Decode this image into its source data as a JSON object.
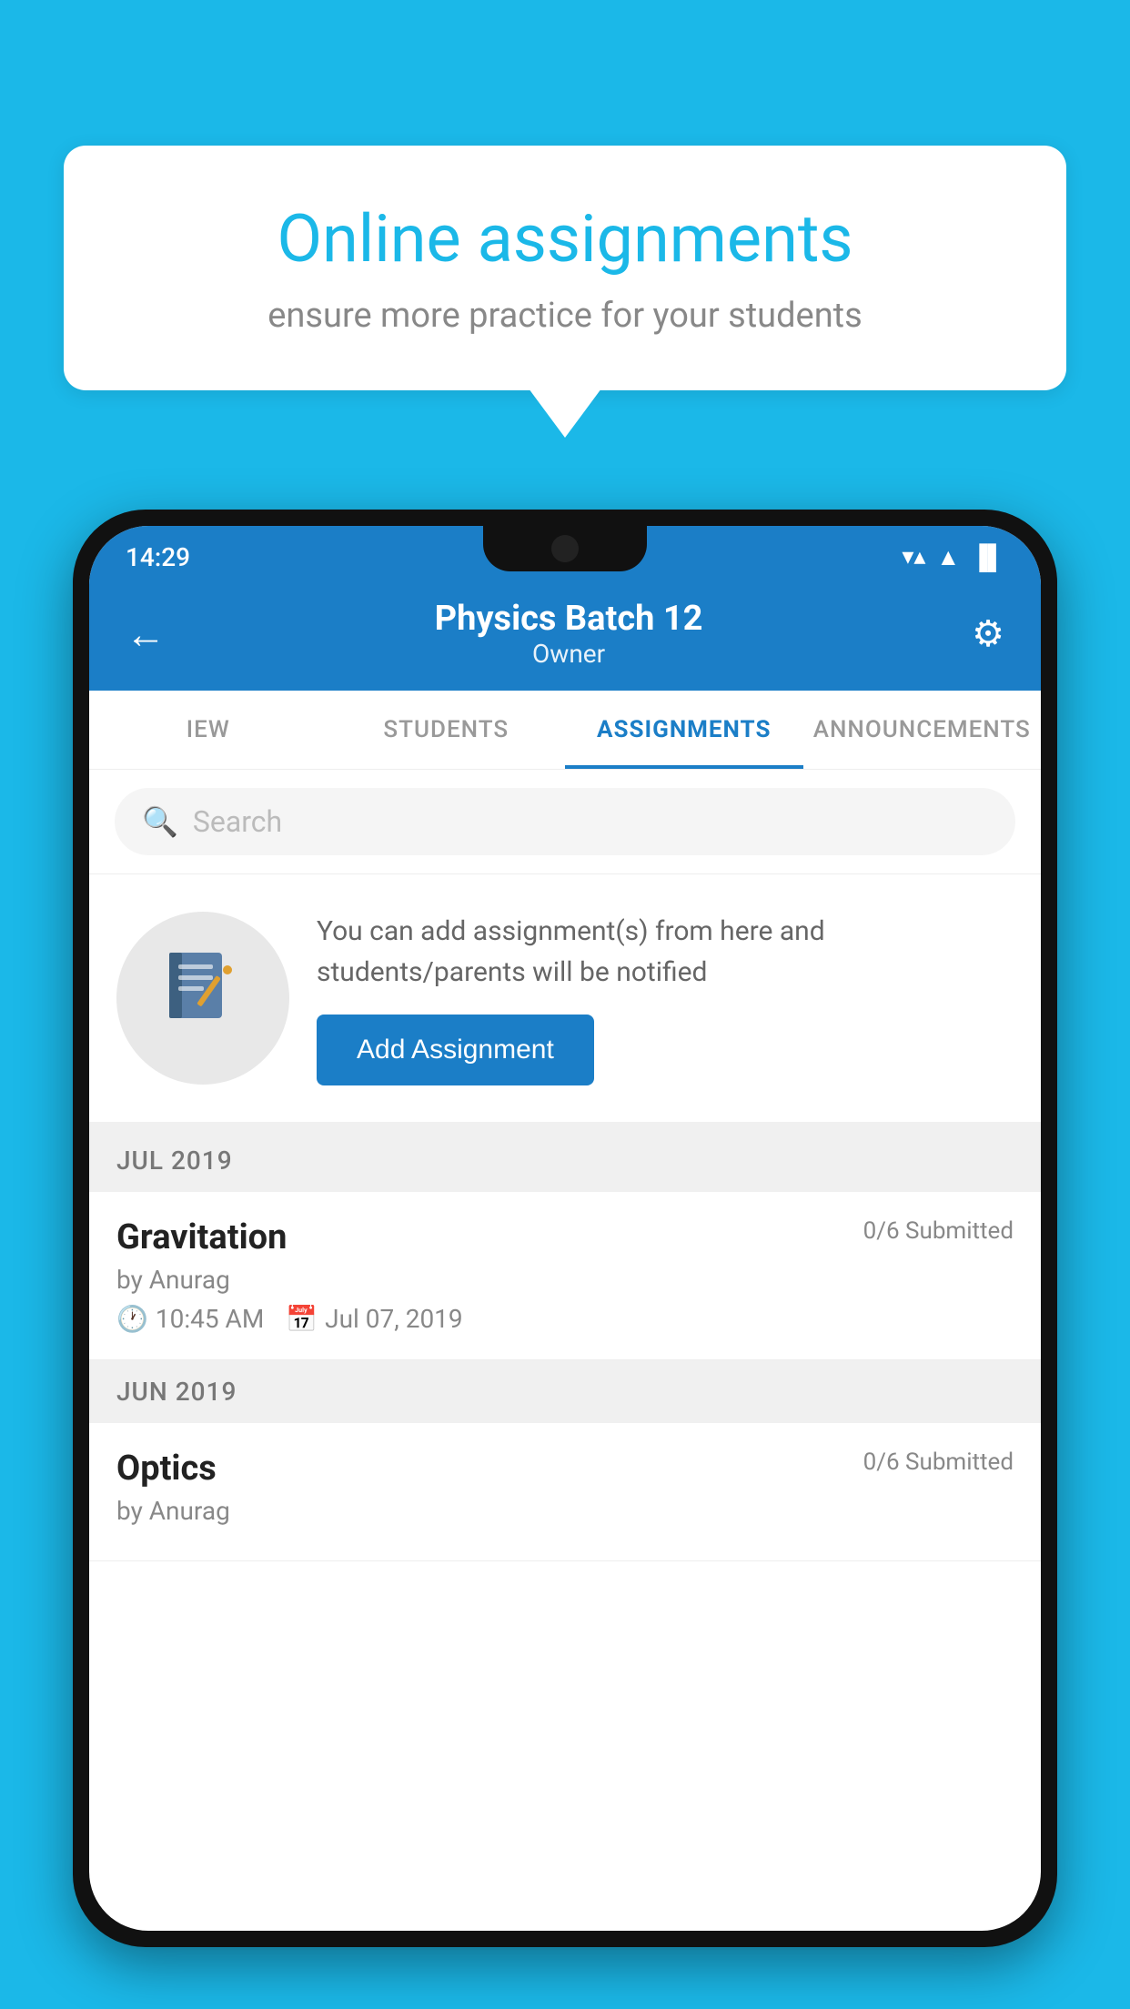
{
  "background_color": "#1BB8E8",
  "speech_bubble": {
    "title": "Online assignments",
    "subtitle": "ensure more practice for your students"
  },
  "phone": {
    "status_bar": {
      "time": "14:29",
      "wifi_icon": "▼",
      "signal_icon": "▲",
      "battery_icon": "▐"
    },
    "header": {
      "back_label": "←",
      "title": "Physics Batch 12",
      "subtitle": "Owner",
      "settings_label": "⚙"
    },
    "tabs": [
      {
        "label": "IEW",
        "active": false
      },
      {
        "label": "STUDENTS",
        "active": false
      },
      {
        "label": "ASSIGNMENTS",
        "active": true
      },
      {
        "label": "ANNOUNCEMENTS",
        "active": false
      }
    ],
    "search": {
      "placeholder": "Search"
    },
    "promo": {
      "icon": "📓",
      "text": "You can add assignment(s) from here and students/parents will be notified",
      "button_label": "Add Assignment"
    },
    "sections": [
      {
        "month_label": "JUL 2019",
        "assignments": [
          {
            "title": "Gravitation",
            "submitted": "0/6 Submitted",
            "by": "by Anurag",
            "time": "10:45 AM",
            "date": "Jul 07, 2019"
          }
        ]
      },
      {
        "month_label": "JUN 2019",
        "assignments": [
          {
            "title": "Optics",
            "submitted": "0/6 Submitted",
            "by": "by Anurag",
            "time": "",
            "date": ""
          }
        ]
      }
    ]
  }
}
